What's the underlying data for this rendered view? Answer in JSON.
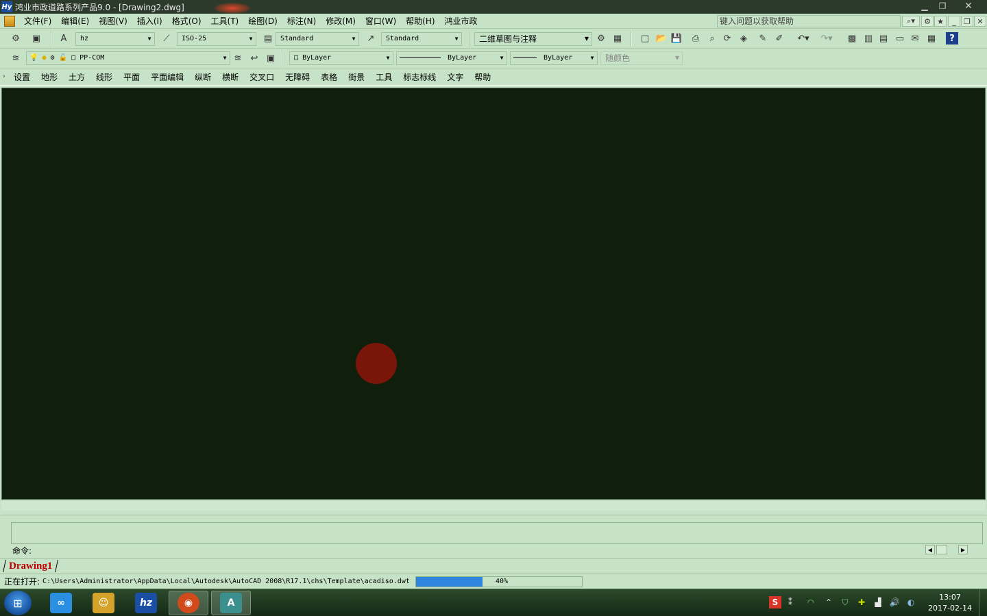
{
  "window": {
    "title": "鸿业市政道路系列产品9.0  - [Drawing2.dwg]",
    "icon": "hy-app-icon",
    "controls": [
      "minimize-icon",
      "restore-icon",
      "close-icon"
    ]
  },
  "menubar": {
    "items": [
      "文件(F)",
      "编辑(E)",
      "视图(V)",
      "插入(I)",
      "格式(O)",
      "工具(T)",
      "绘图(D)",
      "标注(N)",
      "修改(M)",
      "窗口(W)",
      "帮助(H)",
      "鸿业市政"
    ],
    "help_search_placeholder": "键入问题以获取帮助"
  },
  "toolbar1": {
    "text_style": "hz",
    "dim_style": "ISO-25",
    "table_style": "Standard",
    "mleader_style": "Standard",
    "workspace": "二维草图与注释"
  },
  "toolbar2": {
    "layer": "PP-COM",
    "color": "ByLayer",
    "linetype": "ByLayer",
    "lineweight": "ByLayer",
    "plot_style": "随颜色"
  },
  "menu2": {
    "items": [
      "设置",
      "地形",
      "土方",
      "线形",
      "平面",
      "平面编辑",
      "纵断",
      "横断",
      "交叉口",
      "无障碍",
      "表格",
      "街景",
      "工具",
      "标志标线",
      "文字",
      "帮助"
    ]
  },
  "canvas": {
    "background": "#0f1f0b",
    "marker_color": "#7a1509"
  },
  "command": {
    "prompt": "命令:"
  },
  "tabs": {
    "active": "Drawing1"
  },
  "status": {
    "label": "正在打开:",
    "path": "C:\\Users\\Administrator\\AppData\\Local\\Autodesk\\AutoCAD 2008\\R17.1\\chs\\Template\\acadiso.dwt",
    "progress": 0.4,
    "progress_text": "40%"
  },
  "taskbar": {
    "apps": [
      "baidu-netdisk-icon",
      "game-icon",
      "hongye-szicon",
      "ninja-icon",
      "autocad-icon"
    ],
    "clock_time": "13:07",
    "clock_date": "2017-02-14"
  }
}
